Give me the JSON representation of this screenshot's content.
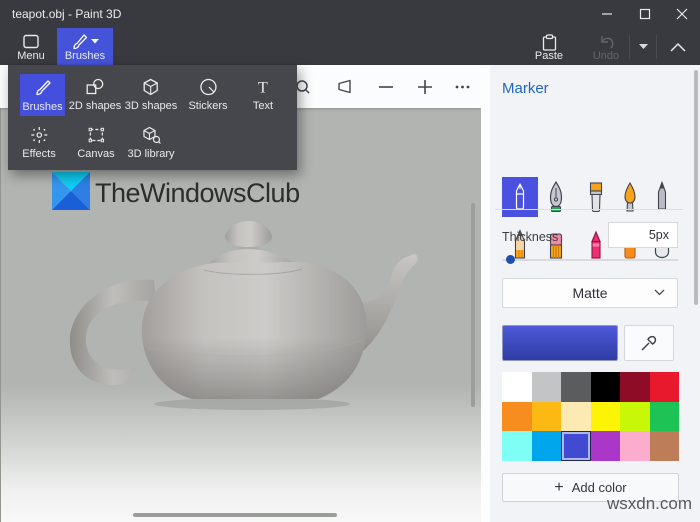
{
  "window": {
    "title": "teapot.obj - Paint 3D"
  },
  "toolbar": {
    "menu_label": "Menu",
    "brushes_label": "Brushes",
    "paste_label": "Paste",
    "undo_label": "Undo"
  },
  "tools_menu": {
    "row1": [
      {
        "id": "brushes",
        "label": "Brushes",
        "selected": true
      },
      {
        "id": "2d-shapes",
        "label": "2D shapes",
        "selected": false
      },
      {
        "id": "3d-shapes",
        "label": "3D shapes",
        "selected": false
      },
      {
        "id": "stickers",
        "label": "Stickers",
        "selected": false
      },
      {
        "id": "text",
        "label": "Text",
        "selected": false
      }
    ],
    "row2": [
      {
        "id": "effects",
        "label": "Effects",
        "selected": false
      },
      {
        "id": "canvas",
        "label": "Canvas",
        "selected": false
      },
      {
        "id": "3d-library",
        "label": "3D library",
        "selected": false
      }
    ]
  },
  "canvas": {
    "logo_text": "TheWindowsClub",
    "object": "utah-teapot"
  },
  "side_panel": {
    "title": "Marker",
    "brush_icons_row1": [
      "marker",
      "calligraphy-pen",
      "oil-brush",
      "watercolor-brush",
      "pixel-pen"
    ],
    "brush_icons_row2": [
      "pencil",
      "eraser",
      "crayon",
      "spray-can",
      "fill-bucket"
    ],
    "selected_brush": "marker",
    "thickness_label": "Thickness",
    "thickness_value": "5px",
    "finish_selected": "Matte",
    "current_color": {
      "gradient_top": "#4e59da",
      "gradient_bottom": "#2f3ca3"
    },
    "palette": [
      "#ffffff",
      "#c3c4c6",
      "#5b5c5e",
      "#000000",
      "#8e0c25",
      "#e8192c",
      "#f78d1e",
      "#fcb813",
      "#fceab2",
      "#fdf305",
      "#c9f708",
      "#1dc455",
      "#7ffef5",
      "#00a6ec",
      "#414bd2",
      "#ab37c8",
      "#fcaccd",
      "#bd7d58"
    ],
    "selected_palette_index": 14,
    "add_color_label": "Add color"
  },
  "watermark": "wsxdn.com",
  "colors": {
    "titlebar": "#393a3f",
    "accent_blue": "#4553d9",
    "tools_panel": "#46474c",
    "marker_title_blue": "#1f66c4"
  }
}
